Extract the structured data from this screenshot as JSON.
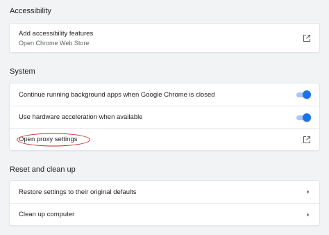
{
  "accessibility": {
    "title": "Accessibility",
    "rows": [
      {
        "label": "Add accessibility features",
        "sublabel": "Open Chrome Web Store",
        "icon": "external-link-icon"
      }
    ]
  },
  "system": {
    "title": "System",
    "rows": [
      {
        "label": "Continue running background apps when Google Chrome is closed",
        "toggle_on": true
      },
      {
        "label": "Use hardware acceleration when available",
        "toggle_on": true
      },
      {
        "label": "Open proxy settings",
        "icon": "external-link-icon",
        "annotation": "red-ellipse"
      }
    ]
  },
  "reset": {
    "title": "Reset and clean up",
    "rows": [
      {
        "label": "Restore settings to their original defaults",
        "icon": "arrow-right-icon"
      },
      {
        "label": "Clean up computer",
        "icon": "arrow-right-icon"
      }
    ]
  },
  "colors": {
    "page_bg": "#f1f3f4",
    "toggle_on": "#1a73e8",
    "annotation": "#c1272d"
  }
}
